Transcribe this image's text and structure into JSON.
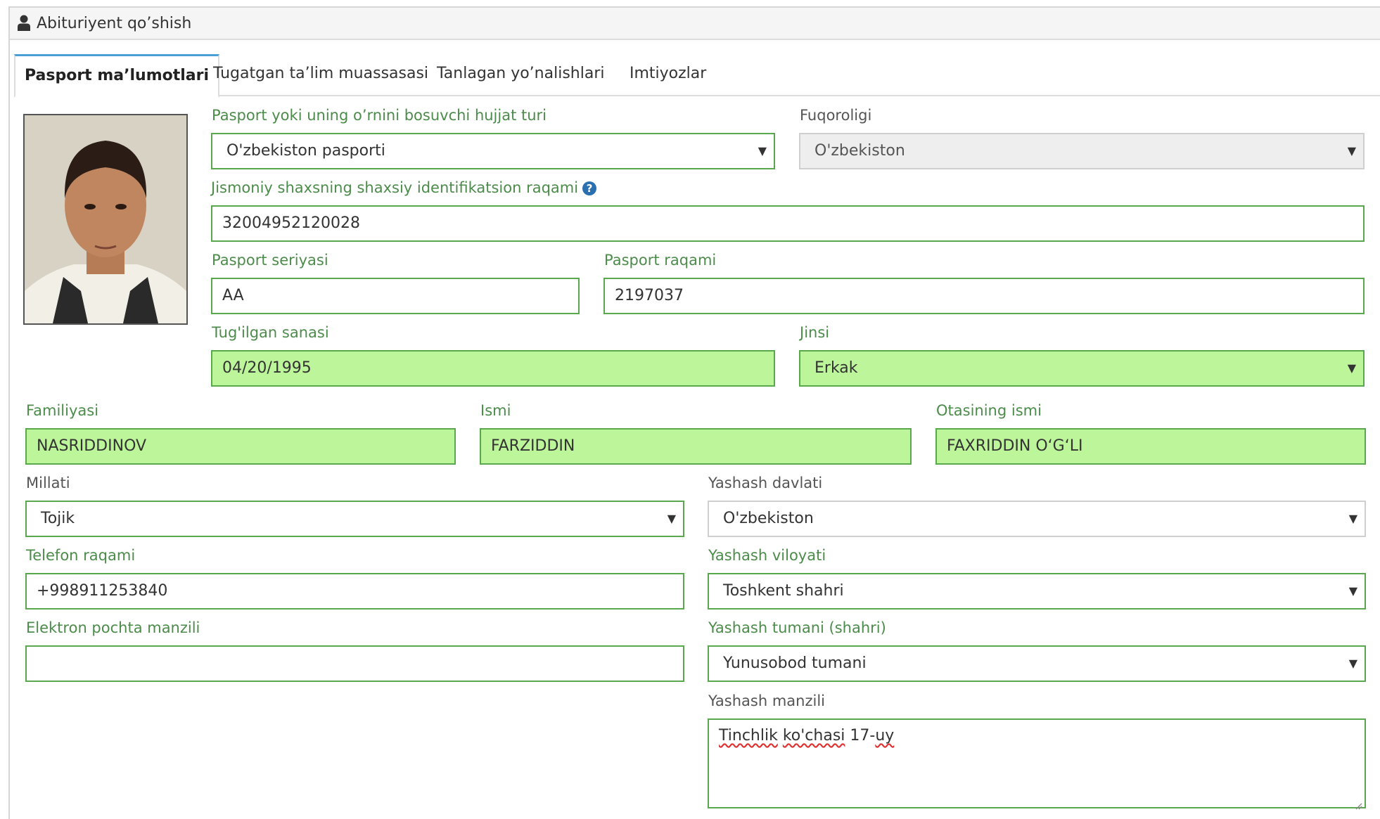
{
  "header": {
    "title": "Abituriyent qo’shish",
    "icon": "user-icon"
  },
  "tabs": [
    {
      "label": "Pasport ma’lumotlari",
      "active": true
    },
    {
      "label": "Tugatgan ta’lim muassasasi",
      "active": false
    },
    {
      "label": "Tanlagan yo’nalishlari",
      "active": false
    },
    {
      "label": "Imtiyozlar",
      "active": false
    }
  ],
  "form": {
    "doc_type": {
      "label": "Pasport yoki uning o’rnini bosuvchi hujjat turi",
      "value": "O'zbekiston pasporti"
    },
    "citizenship": {
      "label": "Fuqoroligi",
      "value": "O'zbekiston"
    },
    "pinfl": {
      "label": "Jismoniy shaxsning shaxsiy identifikatsion raqami",
      "value": "32004952120028",
      "help_icon": "question-circle-icon"
    },
    "passport_series": {
      "label": "Pasport seriyasi",
      "value": "AA"
    },
    "passport_number": {
      "label": "Pasport raqami",
      "value": "2197037"
    },
    "birth_date": {
      "label": "Tug'ilgan sanasi",
      "value": "04/20/1995"
    },
    "gender": {
      "label": "Jinsi",
      "value": "Erkak"
    },
    "surname": {
      "label": "Familiyasi",
      "value": "NASRIDDINOV"
    },
    "name": {
      "label": "Ismi",
      "value": "FARZIDDIN"
    },
    "patronymic": {
      "label": "Otasining ismi",
      "value": "FAXRIDDIN O‘G‘LI"
    },
    "nationality": {
      "label": "Millati",
      "value": "Tojik"
    },
    "residence_country": {
      "label": "Yashash davlati",
      "value": "O'zbekiston"
    },
    "phone": {
      "label": "Telefon raqami",
      "value": "+998911253840"
    },
    "residence_region": {
      "label": "Yashash viloyati",
      "value": "Toshkent shahri"
    },
    "email": {
      "label": "Elektron pochta manzili",
      "value": ""
    },
    "residence_district": {
      "label": "Yashash tumani (shahri)",
      "value": "Yunusobod tumani"
    },
    "address": {
      "label": "Yashash manzili",
      "value_parts": [
        "Tinchlik",
        "ko'chasi",
        "17-",
        "uy"
      ]
    }
  },
  "colors": {
    "label_green": "#4c8c4a",
    "valid_border": "#5aa84e",
    "filled_bg": "#bdf59a",
    "tab_accent": "#4a9fd6"
  }
}
